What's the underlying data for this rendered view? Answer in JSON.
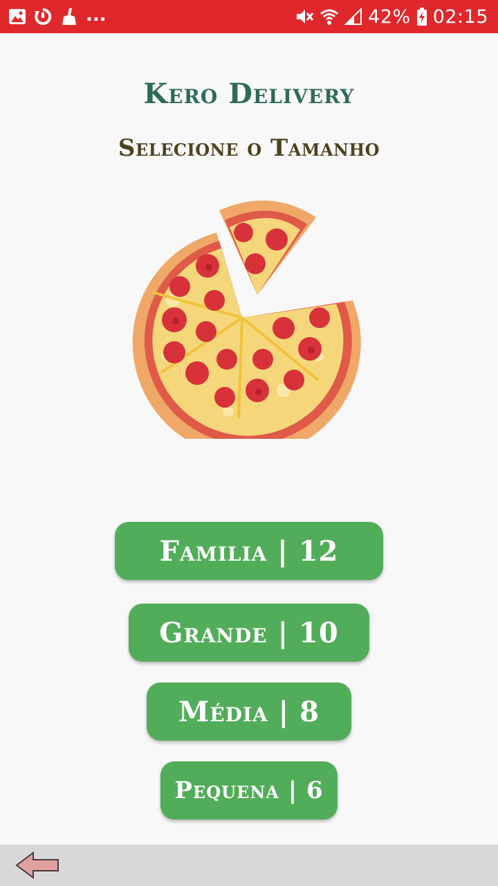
{
  "status_bar": {
    "battery_percent": "42%",
    "time": "02:15",
    "notification_overflow": "...",
    "icons_left": [
      "gallery-icon",
      "sync-icon",
      "cleaner-icon"
    ],
    "icons_right": [
      "mute-icon",
      "wifi-icon",
      "signal-icon",
      "battery-icon"
    ],
    "background_color": "#e0282c"
  },
  "header": {
    "app_title": "Kero Delivery",
    "subtitle": "Selecione o Tamanho",
    "title_color": "#2f6b57",
    "subtitle_color": "#4d4320"
  },
  "hero_image": "pizza-icon",
  "sizes": [
    {
      "label": "Familia | 12"
    },
    {
      "label": "Grande | 10"
    },
    {
      "label": "Média | 8"
    },
    {
      "label": "Pequena | 6"
    }
  ],
  "button_color": "#52ad5a",
  "navigation": {
    "back_icon": "back-arrow-icon"
  }
}
